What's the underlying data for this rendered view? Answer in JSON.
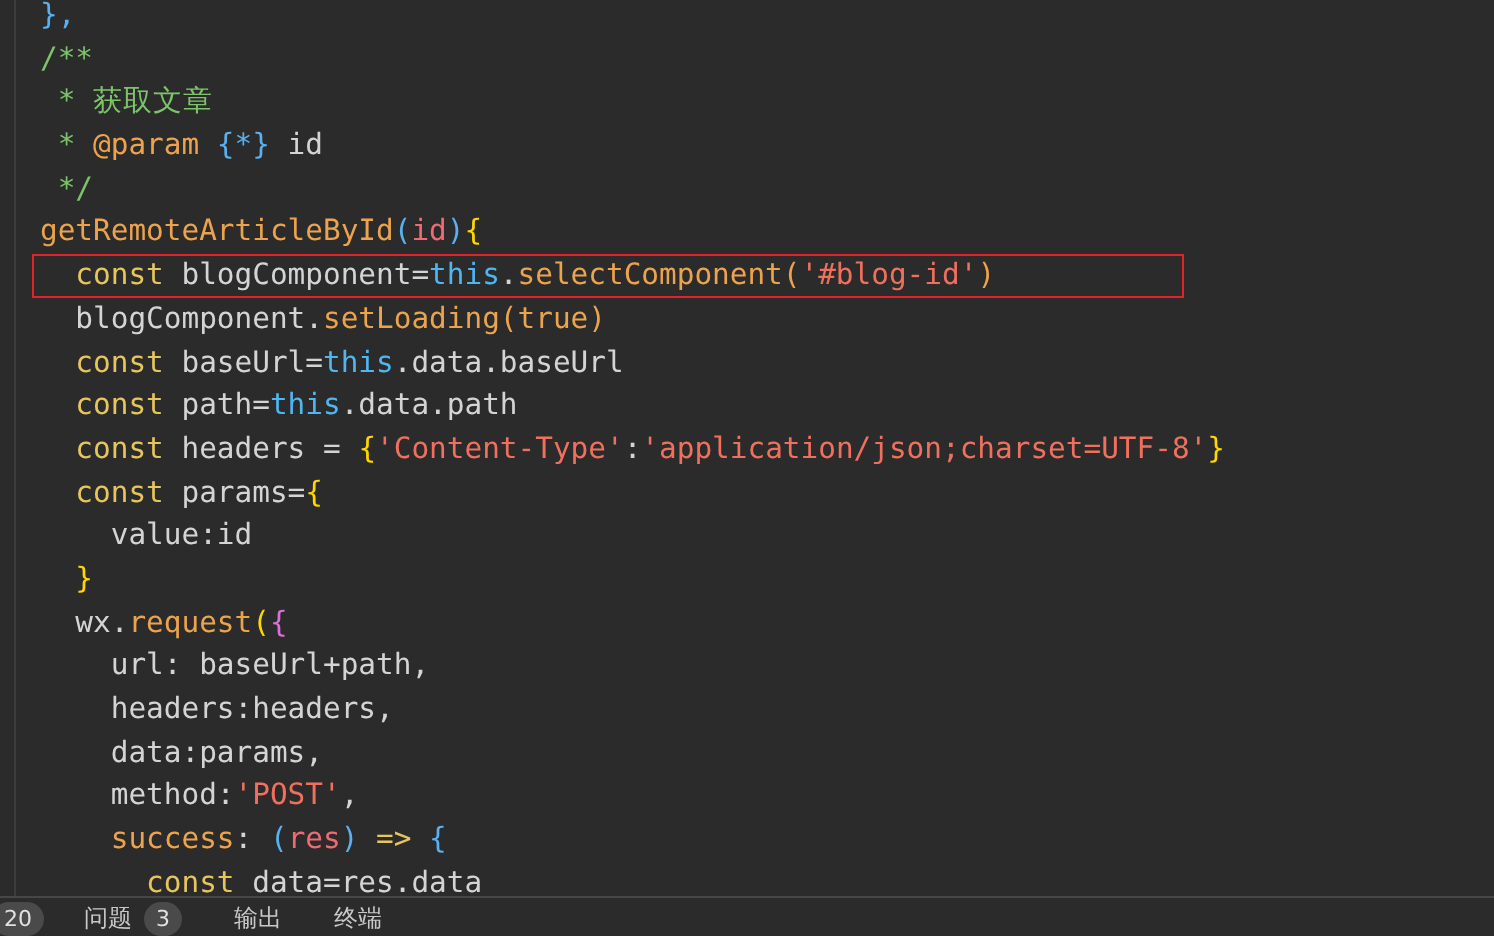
{
  "editor": {
    "lines": [
      {
        "highlighted": false,
        "tokens": [
          {
            "text": "},",
            "kind": "bracket3"
          }
        ]
      },
      {
        "highlighted": false,
        "tokens": [
          {
            "text": "/**",
            "kind": "comment"
          }
        ]
      },
      {
        "highlighted": false,
        "tokens": [
          {
            "text": " * 获取文章",
            "kind": "comment"
          }
        ]
      },
      {
        "highlighted": false,
        "tokens": [
          {
            "text": " * ",
            "kind": "comment"
          },
          {
            "text": "@param",
            "kind": "doc"
          },
          {
            "text": " {*}",
            "kind": "bracket3"
          },
          {
            "text": " id",
            "kind": "plain"
          }
        ]
      },
      {
        "highlighted": false,
        "tokens": [
          {
            "text": " */",
            "kind": "comment"
          }
        ]
      },
      {
        "highlighted": false,
        "tokens": [
          {
            "text": "getRemoteArticleById",
            "kind": "func"
          },
          {
            "text": "(",
            "kind": "bracket3"
          },
          {
            "text": "id",
            "kind": "param"
          },
          {
            "text": ")",
            "kind": "bracket3"
          },
          {
            "text": "{",
            "kind": "bracket1"
          }
        ]
      },
      {
        "highlighted": true,
        "tokens": [
          {
            "text": "  const",
            "kind": "keyword"
          },
          {
            "text": " blogComponent=",
            "kind": "plain"
          },
          {
            "text": "this",
            "kind": "this"
          },
          {
            "text": ".",
            "kind": "plain"
          },
          {
            "text": "selectComponent",
            "kind": "func"
          },
          {
            "text": "(",
            "kind": "func"
          },
          {
            "text": "'#blog-id'",
            "kind": "string"
          },
          {
            "text": ")",
            "kind": "func"
          }
        ]
      },
      {
        "highlighted": false,
        "tokens": [
          {
            "text": "  blogComponent.",
            "kind": "plain"
          },
          {
            "text": "setLoading",
            "kind": "func"
          },
          {
            "text": "(",
            "kind": "func"
          },
          {
            "text": "true",
            "kind": "func"
          },
          {
            "text": ")",
            "kind": "func"
          }
        ]
      },
      {
        "highlighted": false,
        "tokens": [
          {
            "text": "  const",
            "kind": "keyword"
          },
          {
            "text": " baseUrl=",
            "kind": "plain"
          },
          {
            "text": "this",
            "kind": "this"
          },
          {
            "text": ".data.baseUrl",
            "kind": "plain"
          }
        ]
      },
      {
        "highlighted": false,
        "tokens": [
          {
            "text": "  const",
            "kind": "keyword"
          },
          {
            "text": " path=",
            "kind": "plain"
          },
          {
            "text": "this",
            "kind": "this"
          },
          {
            "text": ".data.path",
            "kind": "plain"
          }
        ]
      },
      {
        "highlighted": false,
        "tokens": [
          {
            "text": "  const",
            "kind": "keyword"
          },
          {
            "text": " headers = ",
            "kind": "plain"
          },
          {
            "text": "{",
            "kind": "bracket1"
          },
          {
            "text": "'Content-Type'",
            "kind": "string"
          },
          {
            "text": ":",
            "kind": "plain"
          },
          {
            "text": "'application/json;charset=UTF-8'",
            "kind": "string"
          },
          {
            "text": "}",
            "kind": "bracket1"
          }
        ]
      },
      {
        "highlighted": false,
        "tokens": [
          {
            "text": "  const",
            "kind": "keyword"
          },
          {
            "text": " params=",
            "kind": "plain"
          },
          {
            "text": "{",
            "kind": "bracket1"
          }
        ]
      },
      {
        "highlighted": false,
        "tokens": [
          {
            "text": "    value:id",
            "kind": "plain"
          }
        ]
      },
      {
        "highlighted": false,
        "tokens": [
          {
            "text": "  }",
            "kind": "bracket1"
          }
        ]
      },
      {
        "highlighted": false,
        "tokens": [
          {
            "text": "  wx.",
            "kind": "plain"
          },
          {
            "text": "request",
            "kind": "func"
          },
          {
            "text": "(",
            "kind": "bracket1"
          },
          {
            "text": "{",
            "kind": "bracket2"
          }
        ]
      },
      {
        "highlighted": false,
        "tokens": [
          {
            "text": "    url: baseUrl+path,",
            "kind": "plain"
          }
        ]
      },
      {
        "highlighted": false,
        "tokens": [
          {
            "text": "    headers:headers,",
            "kind": "plain"
          }
        ]
      },
      {
        "highlighted": false,
        "tokens": [
          {
            "text": "    data:params,",
            "kind": "plain"
          }
        ]
      },
      {
        "highlighted": false,
        "tokens": [
          {
            "text": "    method:",
            "kind": "plain"
          },
          {
            "text": "'POST'",
            "kind": "string"
          },
          {
            "text": ",",
            "kind": "plain"
          }
        ]
      },
      {
        "highlighted": false,
        "tokens": [
          {
            "text": "    success",
            "kind": "func"
          },
          {
            "text": ": ",
            "kind": "plain"
          },
          {
            "text": "(",
            "kind": "bracket3"
          },
          {
            "text": "res",
            "kind": "param"
          },
          {
            "text": ")",
            "kind": "bracket3"
          },
          {
            "text": " =>",
            "kind": "keyword"
          },
          {
            "text": " {",
            "kind": "bracket3"
          }
        ]
      },
      {
        "highlighted": false,
        "tokens": [
          {
            "text": "      const",
            "kind": "keyword"
          },
          {
            "text": " data=res.data",
            "kind": "plain"
          }
        ]
      }
    ]
  },
  "panel": {
    "items": [
      {
        "kind": "badge",
        "text": "20"
      },
      {
        "kind": "tab",
        "label": "问题",
        "badge": "3"
      },
      {
        "kind": "tab",
        "label": "输出"
      },
      {
        "kind": "tab",
        "label": "终端"
      }
    ]
  }
}
